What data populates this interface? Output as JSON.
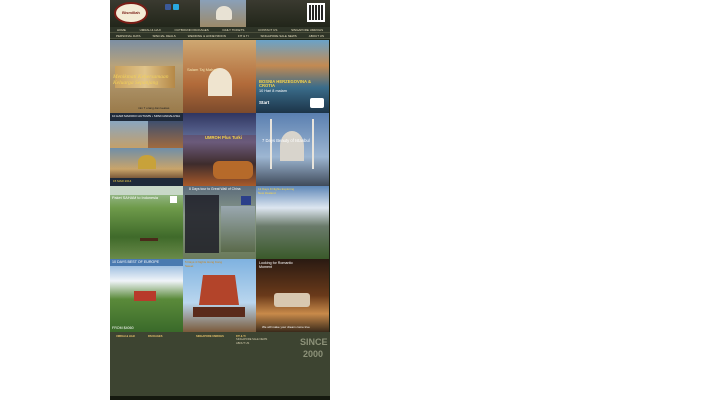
{
  "header": {
    "logo_text": "Bismillah",
    "middle_text": "",
    "contact_lines": [
      "",
      "",
      "",
      "",
      "",
      ""
    ]
  },
  "nav_row1": [
    "HOME",
    "UMRAH & HAJI",
    "OUTBOUND PACKAGES",
    "DAILY TICKETS",
    "CONTACT US",
    "SINGAPORE UMROHS"
  ],
  "nav_row2": [
    "PERSONAL DATA",
    "SPECIAL DEALS",
    "WEDDING & HONEYMOON",
    "FIT & TI",
    "SINGAPORE SALE NEWS",
    "ABOUT US"
  ],
  "tiles": {
    "t1": {
      "title": "Menikmati Kebersamaan Keluarga Sepanjang",
      "caption": "min 7 orang dan keatas"
    },
    "t2": {
      "title": "Salam Taj Mahal",
      "sub": "",
      "caption": ""
    },
    "t3": {
      "title": "BOSNIA HERZEGOVINA & CROTIA",
      "sub": "10 Hari 8 malam",
      "price_label": "Start",
      "price": ""
    },
    "t4": {
      "title": "10 HARI MAROKO AUTUMN • SPAIN ANDALUSIA",
      "sub": "",
      "caption": "15 MAR 2014"
    },
    "t5": {
      "title": "UMROH Plus Turki",
      "sub": "",
      "caption": ""
    },
    "t6": {
      "title": "7 Days Beauty of Istanbul",
      "sub": ""
    },
    "t7": {
      "title": "Paket SAHAM to Indonesia",
      "caption": ""
    },
    "t8": {
      "title": "8 Days tour to Great Wall of China",
      "sub": "",
      "caption": ""
    },
    "t9": {
      "title": "12 Days 9 Nights Exploring New Zealand",
      "caption": ""
    },
    "t10": {
      "title": "10 DAYS BEST OF EUROPE",
      "caption": "FROM $4060"
    },
    "t11": {
      "title": "5 Days 4 Nights Hong Kong Sweet",
      "caption": ""
    },
    "t12": {
      "title": "Looking for Romantic Moment",
      "caption": "We will make your dream come true"
    }
  },
  "footer": {
    "col1_title": "UMRAH & HAJI",
    "col1_items": [
      ""
    ],
    "col2_title": "PACKAGES",
    "col2_items": [
      ""
    ],
    "col3_title": "SINGAPORE UMROHS",
    "col3_items": [
      ""
    ],
    "col4_title": "FIT & TI",
    "col4_items": [
      "SINGAPORE SALE NEWS",
      "ABOUT US"
    ],
    "seal_text": "SINCE 2000"
  },
  "copyright": ""
}
